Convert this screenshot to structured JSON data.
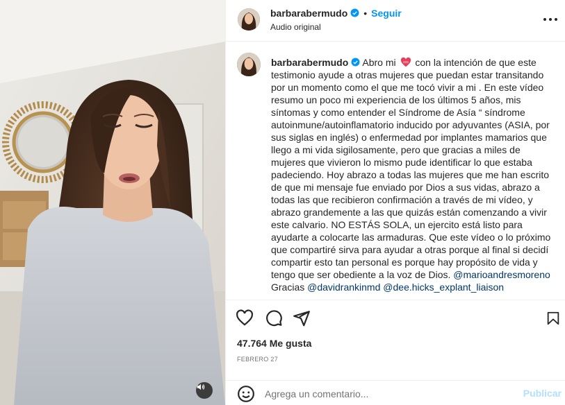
{
  "post": {
    "username": "barbarabermudo",
    "separator": "•",
    "follow_label": "Seguir",
    "audio_label": "Audio original",
    "more_icon": "more-horizontal-icon"
  },
  "caption": {
    "username": "barbarabermudo",
    "part1": "Abro mi",
    "part2": "con la intención de que este testimonio ayude a otras mujeres que puedan estar transitando por un momento como el que me tocó vivir a mi . En este vídeo resumo un poco mi experiencia de los últimos 5 años, mis síntomas y como entender el Síndrome de Asía “ síndrome autoinmune/autoinflamatorio inducido por adyuvantes (ASIA, por sus siglas en inglés) o enfermedad por implantes mamarios que llego a mi vida sigilosamente, pero que gracias a miles de mujeres que vivieron lo mismo pude identificar lo que estaba padeciendo. Hoy abrazo a todas las mujeres que me han escrito de que mi mensaje fue enviado por Dios a sus vidas, abrazo a todas las que recibieron confirmación a través de mi vídeo, y abrazo grandemente a las que quizás están comenzando a vivir este calvario. NO ESTÁS SOLA, un ejercito está listo para ayudarte a colocarte las armaduras. Que este vídeo o lo próximo que compartiré sirva para ayudar a otras porque al final si decidí compartir esto tan personal es porque hay propósito de vida y tengo que ser obediente a la voz de Dios.",
    "mention1": "@marioandresmoreno",
    "thanks": "Gracias",
    "mention2": "@davidrankinmd",
    "mention3": "@dee.hicks_explant_liaison"
  },
  "stats": {
    "likes": "47.764 Me gusta",
    "date": "FEBRERO 27"
  },
  "comment": {
    "placeholder": "Agrega un comentario...",
    "publish_label": "Publicar"
  },
  "colors": {
    "accent": "#0095f6",
    "mention": "#00376b",
    "publish_disabled": "#b2dffc",
    "muted_text": "#737373",
    "heart": "#e83e5b"
  }
}
